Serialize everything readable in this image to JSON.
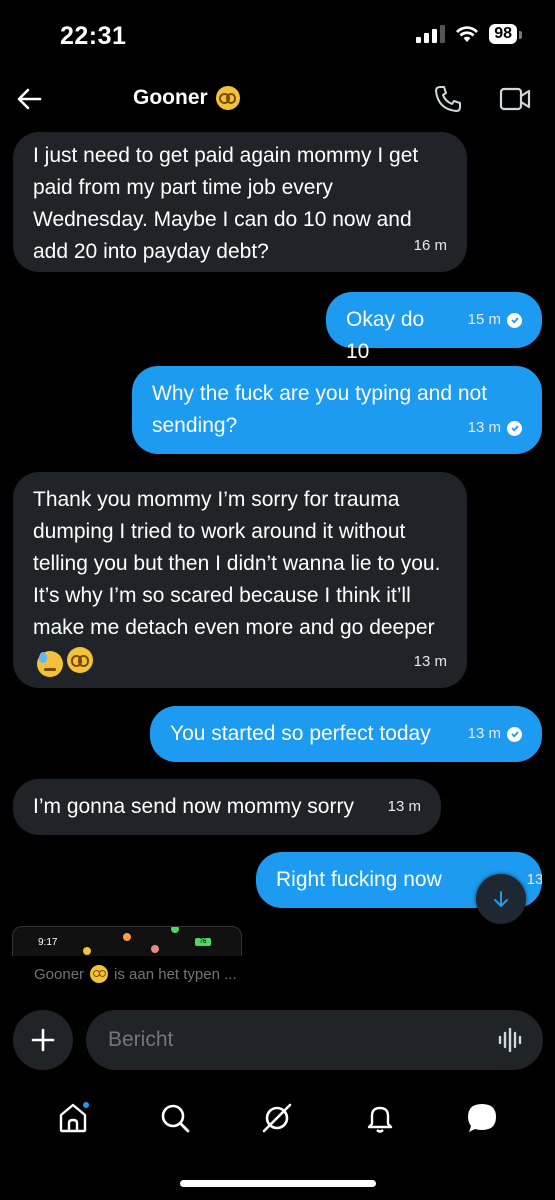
{
  "status_bar": {
    "time": "22:31",
    "battery": "98"
  },
  "header": {
    "title": "Gooner",
    "title_emoji": "flushed-face-emoji"
  },
  "messages": [
    {
      "dir": "in",
      "text": "I just need to get paid again mommy I get paid from my part time job every Wednesday. Maybe I can do 10 now and add 20 into payday debt?",
      "time": "16 m"
    },
    {
      "dir": "out",
      "text": "Okay do 10",
      "time": "15 m"
    },
    {
      "dir": "out",
      "text": "Why the fuck are you typing and not sending?",
      "time": "13 m"
    },
    {
      "dir": "in",
      "text": "Thank you mommy I’m sorry for trauma dumping I tried to work around it without telling you but then I didn’t wanna lie to you. It’s why I’m so scared because I think it’ll make me detach even more and go deeper",
      "time": "13 m"
    },
    {
      "dir": "out",
      "text": "You started so perfect today",
      "time": "13 m"
    },
    {
      "dir": "in",
      "text": "I’m gonna send now mommy sorry",
      "time": "13 m"
    },
    {
      "dir": "out",
      "text": "Right fucking now",
      "time": "13 m"
    }
  ],
  "attachment_preview": {
    "time": "9:17",
    "battery": "76"
  },
  "typing_indicator": {
    "name": "Gooner",
    "text": "is aan het typen ..."
  },
  "composer": {
    "placeholder": "Bericht"
  },
  "tabs": [
    "home-icon",
    "search-icon",
    "grok-icon",
    "notifications-icon",
    "messages-icon"
  ],
  "colors": {
    "accent": "#1d9bf0",
    "incoming_bubble": "#202327",
    "background": "#000000"
  }
}
